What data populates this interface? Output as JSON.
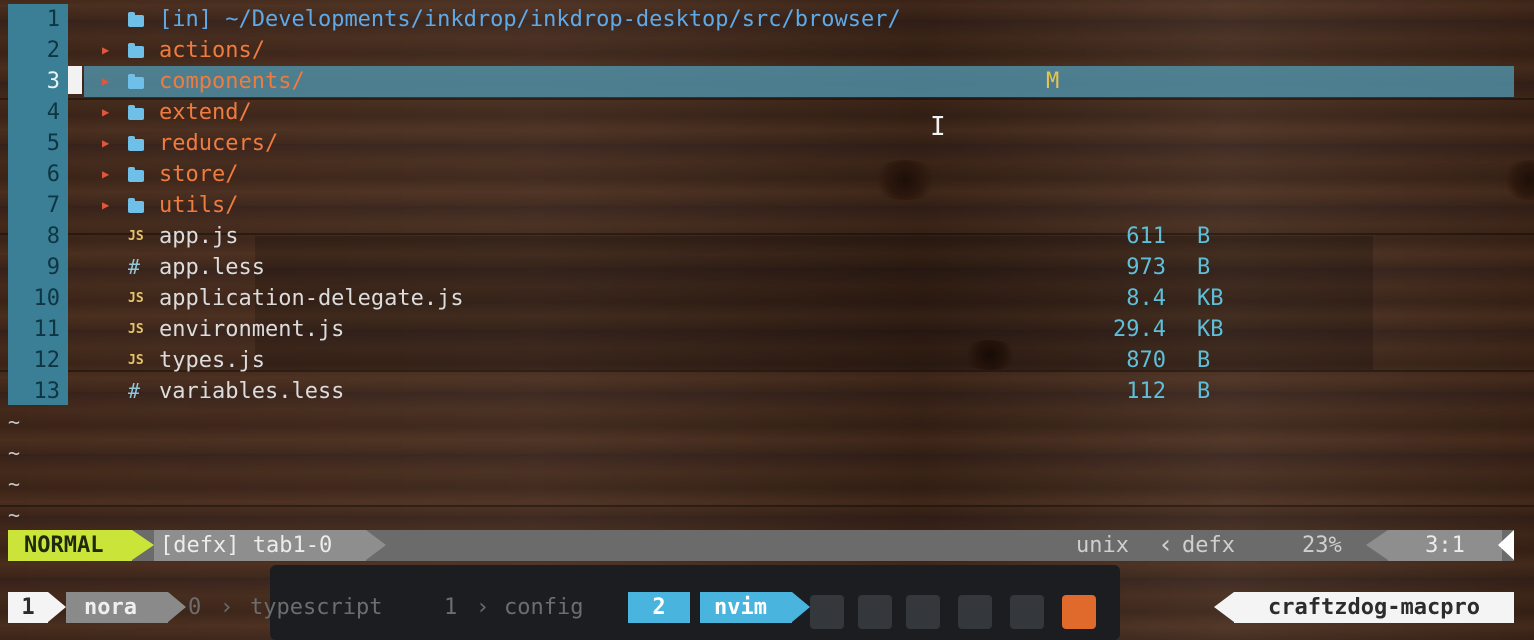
{
  "line_numbers": [
    "1",
    "2",
    "3",
    "4",
    "5",
    "6",
    "7",
    "8",
    "9",
    "10",
    "11",
    "12",
    "13"
  ],
  "current_line": "3",
  "header": {
    "tag": "[in]",
    "path": "~/Developments/inkdrop/inkdrop-desktop/src/browser/"
  },
  "entries": [
    {
      "name": "actions/",
      "type": "dir"
    },
    {
      "name": "components/",
      "type": "dir",
      "flag": "M",
      "selected": true
    },
    {
      "name": "extend/",
      "type": "dir"
    },
    {
      "name": "reducers/",
      "type": "dir"
    },
    {
      "name": "store/",
      "type": "dir"
    },
    {
      "name": "utils/",
      "type": "dir"
    },
    {
      "name": "app.js",
      "type": "js",
      "size": "611",
      "unit": "B"
    },
    {
      "name": "app.less",
      "type": "less",
      "size": "973",
      "unit": "B"
    },
    {
      "name": "application-delegate.js",
      "type": "js",
      "size": "8.4",
      "unit": "KB"
    },
    {
      "name": "environment.js",
      "type": "js",
      "size": "29.4",
      "unit": "KB"
    },
    {
      "name": "types.js",
      "type": "js",
      "size": "870",
      "unit": "B"
    },
    {
      "name": "variables.less",
      "type": "less",
      "size": "112",
      "unit": "B"
    }
  ],
  "icons": {
    "dir": "folder-icon",
    "js": "JS",
    "less": "#"
  },
  "tilde": "~",
  "statusline": {
    "mode": "NORMAL",
    "file": "[defx] tab1-0",
    "fileformat": "unix",
    "sep": "‹",
    "filetype": "defx",
    "percent": "23%",
    "position": "3:1"
  },
  "tmux": {
    "session_index": "1",
    "session_name": "nora",
    "windows": [
      {
        "index": "0",
        "name": "typescript"
      },
      {
        "index": "1",
        "name": "config"
      }
    ],
    "active_window": {
      "index": "2",
      "name": "nvim"
    },
    "hostname": "craftzdog-macpro"
  },
  "colors": {
    "gutter": "#3a7f95",
    "directory": "#f07b3f",
    "path": "#5fa9e6",
    "size": "#5fbfd9",
    "mode_bg": "#cbe43a",
    "tmux_active": "#49b5df"
  }
}
